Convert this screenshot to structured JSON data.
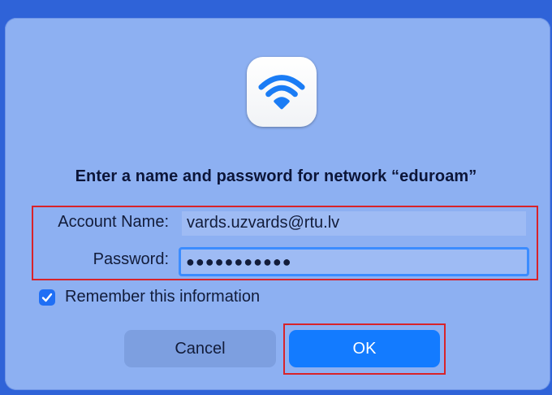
{
  "dialog": {
    "title": "Enter a name and password for network “eduroam”",
    "icon": "wifi-icon"
  },
  "fields": {
    "account_label": "Account Name:",
    "account_value": "vards.uzvards@rtu.lv",
    "password_label": "Password:",
    "password_value": "●●●●●●●●●●●"
  },
  "remember": {
    "label": "Remember this information",
    "checked": true
  },
  "buttons": {
    "cancel_label": "Cancel",
    "ok_label": "OK"
  },
  "colors": {
    "panel": "#8db0f2",
    "accent": "#137bff",
    "highlight_frame": "#d8232a"
  }
}
